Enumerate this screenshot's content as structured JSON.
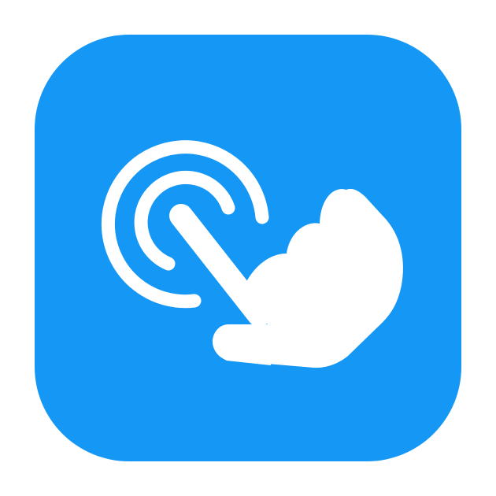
{
  "app_icon": {
    "icon": "tap-gesture-icon",
    "parts": [
      "ripple-rings-icon",
      "pointing-hand-icon"
    ],
    "colors": {
      "background": "#1597F5",
      "glyph": "#FFFFFF",
      "page": "#FFFFFF"
    }
  }
}
